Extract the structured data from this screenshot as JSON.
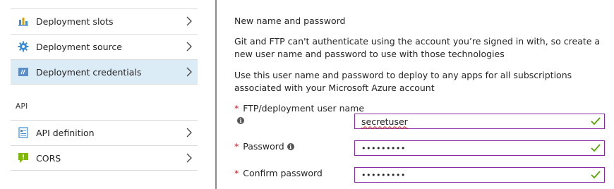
{
  "sidebar": {
    "items": [
      {
        "label": "Deployment slots",
        "icon": "deployment-slots-icon"
      },
      {
        "label": "Deployment source",
        "icon": "gear-icon"
      },
      {
        "label": "Deployment credentials",
        "icon": "credentials-icon",
        "selected": true
      }
    ],
    "section_label": "API",
    "api_items": [
      {
        "label": "API definition",
        "icon": "api-definition-icon"
      },
      {
        "label": "CORS",
        "icon": "cors-icon"
      }
    ]
  },
  "form": {
    "heading": "New name and password",
    "intro": "Git and FTP can't authenticate using the account you’re signed in with, so create a new user name and password to use with those technologies",
    "note": "Use this user name and password to deploy to any apps for all subscriptions associated with your Microsoft Azure account",
    "required_marker": "*",
    "fields": {
      "username": {
        "label": "FTP/deployment user name",
        "value": "secretuser"
      },
      "password": {
        "label": "Password",
        "value": "•••••••••"
      },
      "confirm": {
        "label": "Confirm password",
        "value": "•••••••••"
      }
    }
  },
  "colors": {
    "selected_bg": "#dcecf7",
    "input_border": "#8a2aa0",
    "valid_check": "#57a300",
    "required": "#e00b1c"
  }
}
